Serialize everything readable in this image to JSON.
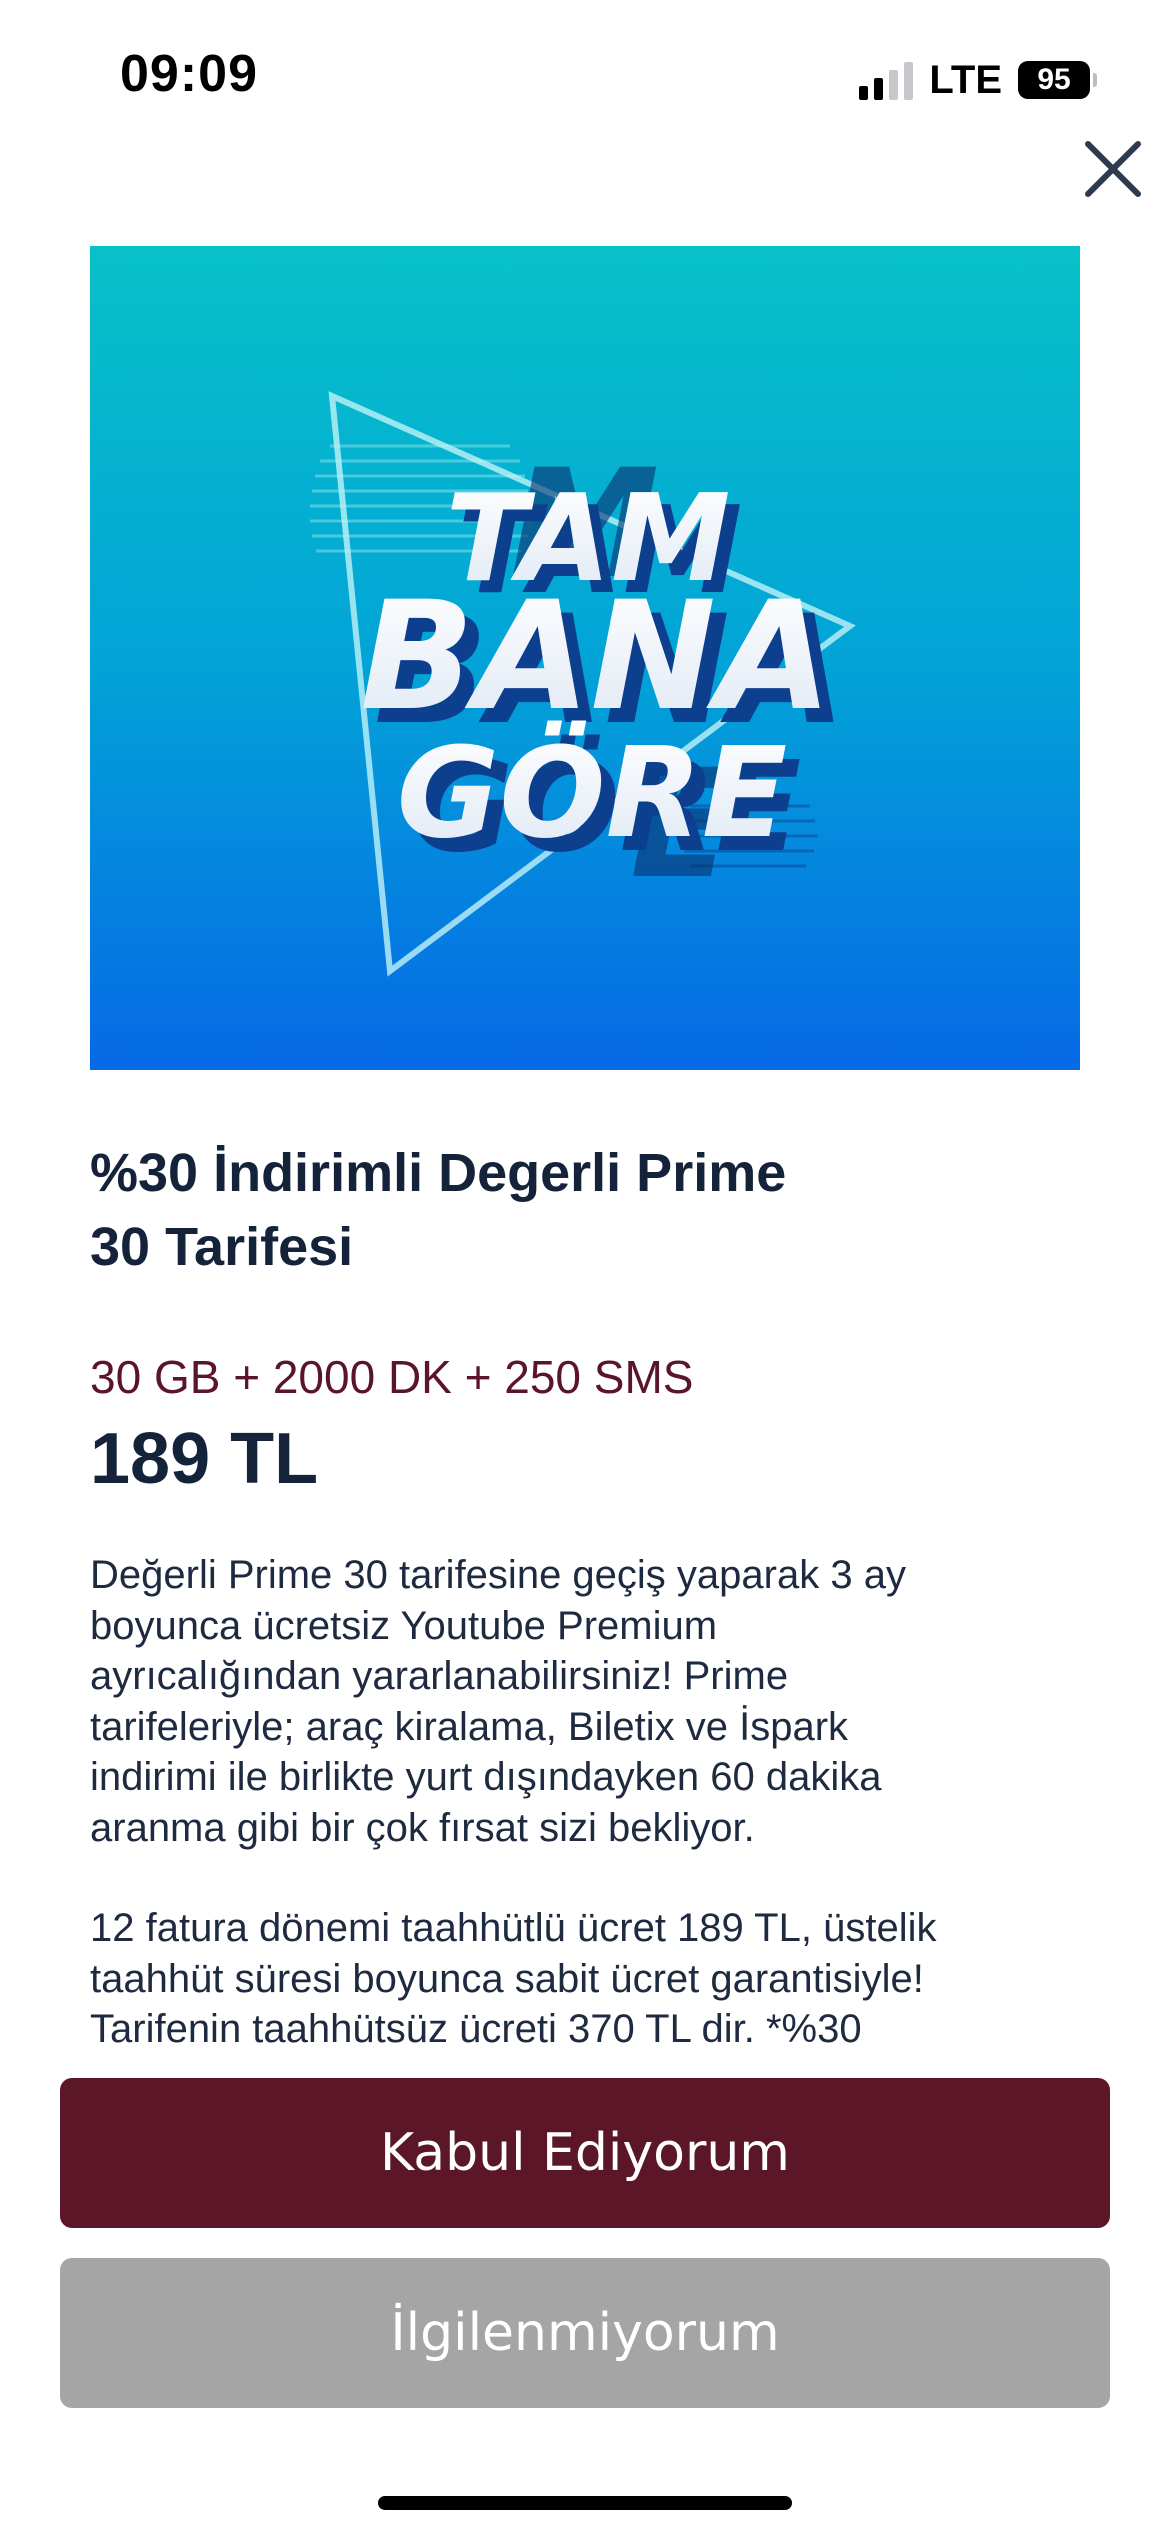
{
  "status_bar": {
    "time": "09:09",
    "network": "LTE",
    "battery": "95"
  },
  "close": {
    "icon": "close-icon"
  },
  "banner": {
    "lines": [
      "TAM",
      "BANA",
      "GÖRE"
    ],
    "colors": {
      "top": "#08c1c8",
      "bottom": "#0669e6"
    }
  },
  "offer": {
    "title_line1": "%30 İndirimli Degerli Prime",
    "title_line2": "30 Tarifesi",
    "package": "30 GB + 2000 DK + 250 SMS",
    "price": "189 TL",
    "description": {
      "p1": [
        "Değerli Prime 30 tarifesine geçiş yaparak 3 ay",
        "boyunca ücretsiz Youtube Premium",
        "ayrıcalığından yararlanabilirsiniz! Prime",
        "tarifeleriyle; araç kiralama, Biletix ve İspark",
        "indirimi ile birlikte yurt dışındayken 60 dakika",
        "aranma gibi bir çok fırsat sizi bekliyor."
      ],
      "p2": [
        "12 fatura dönemi taahhütlü ücret 189 TL, üstelik",
        "taahhüt süresi boyunca sabit ücret garantisiyle!",
        "Tarifenin taahhütsüz ücreti 370 TL dir. *%30"
      ]
    }
  },
  "actions": {
    "accept": "Kabul Ediyorum",
    "decline": "İlgilenmiyorum"
  },
  "colors": {
    "accept_bg": "#5b1628",
    "decline_bg": "#a5a5a5",
    "title": "#14233a",
    "package": "#5a1628"
  }
}
